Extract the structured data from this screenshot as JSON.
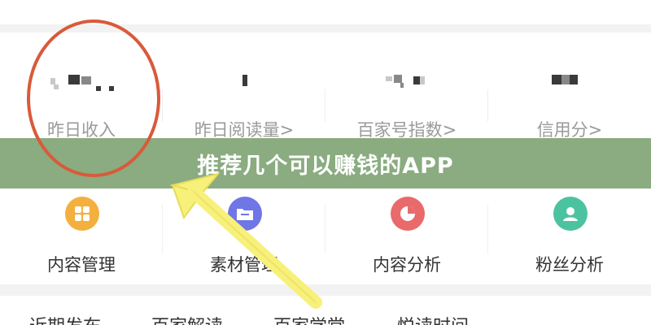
{
  "stats": {
    "items": [
      {
        "label": "昨日收入"
      },
      {
        "label": "昨日阅读量>"
      },
      {
        "label": "百家号指数>"
      },
      {
        "label": "信用分>"
      }
    ]
  },
  "banner": {
    "title": "推荐几个可以赚钱的APP",
    "background": "#7aa06e"
  },
  "tools": {
    "items": [
      {
        "label": "内容管理",
        "icon": "grid-icon",
        "color": "#f4b03e"
      },
      {
        "label": "素材管理",
        "icon": "folder-icon",
        "color": "#6f76e6"
      },
      {
        "label": "内容分析",
        "icon": "pie-chart-icon",
        "color": "#e96a6a"
      },
      {
        "label": "粉丝分析",
        "icon": "user-icon",
        "color": "#4cc3a0"
      }
    ]
  },
  "bottom_tabs": {
    "items": [
      {
        "label": "近期发布"
      },
      {
        "label": "百家解读"
      },
      {
        "label": "百家学堂"
      },
      {
        "label": "悦读时间"
      }
    ]
  },
  "annotations": {
    "circle_color": "#d95a3a",
    "arrow_color": "#f7f07a"
  }
}
